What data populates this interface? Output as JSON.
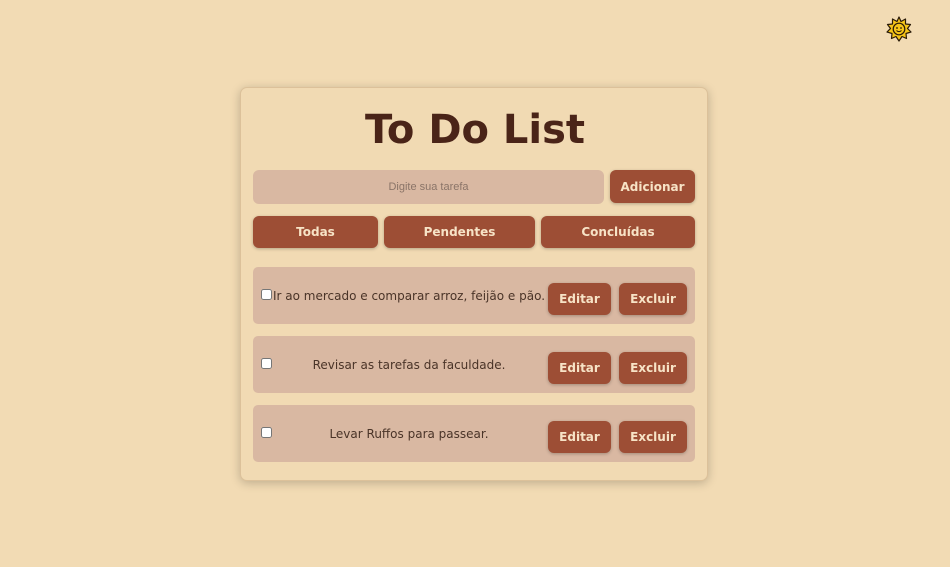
{
  "theme_toggle": {
    "icon": "sun-icon",
    "color": "#f5c518"
  },
  "app": {
    "title": "To Do List",
    "input_placeholder": "Digite sua tarefa",
    "add_label": "Adicionar"
  },
  "filters": {
    "all_label": "Todas",
    "pending_label": "Pendentes",
    "done_label": "Concluídas"
  },
  "tasks": [
    {
      "text": "Ir ao mercado e comparar arroz, feijão e pão.",
      "checked": false,
      "edit_label": "Editar",
      "delete_label": "Excluir"
    },
    {
      "text": "Revisar as tarefas da faculdade.",
      "checked": false,
      "edit_label": "Editar",
      "delete_label": "Excluir"
    },
    {
      "text": "Levar Ruffos para passear.",
      "checked": false,
      "edit_label": "Editar",
      "delete_label": "Excluir"
    }
  ],
  "colors": {
    "background": "#f2dbb4",
    "accent": "#9d4e35",
    "task_bg": "#d9b8a2",
    "title": "#4a2418"
  }
}
